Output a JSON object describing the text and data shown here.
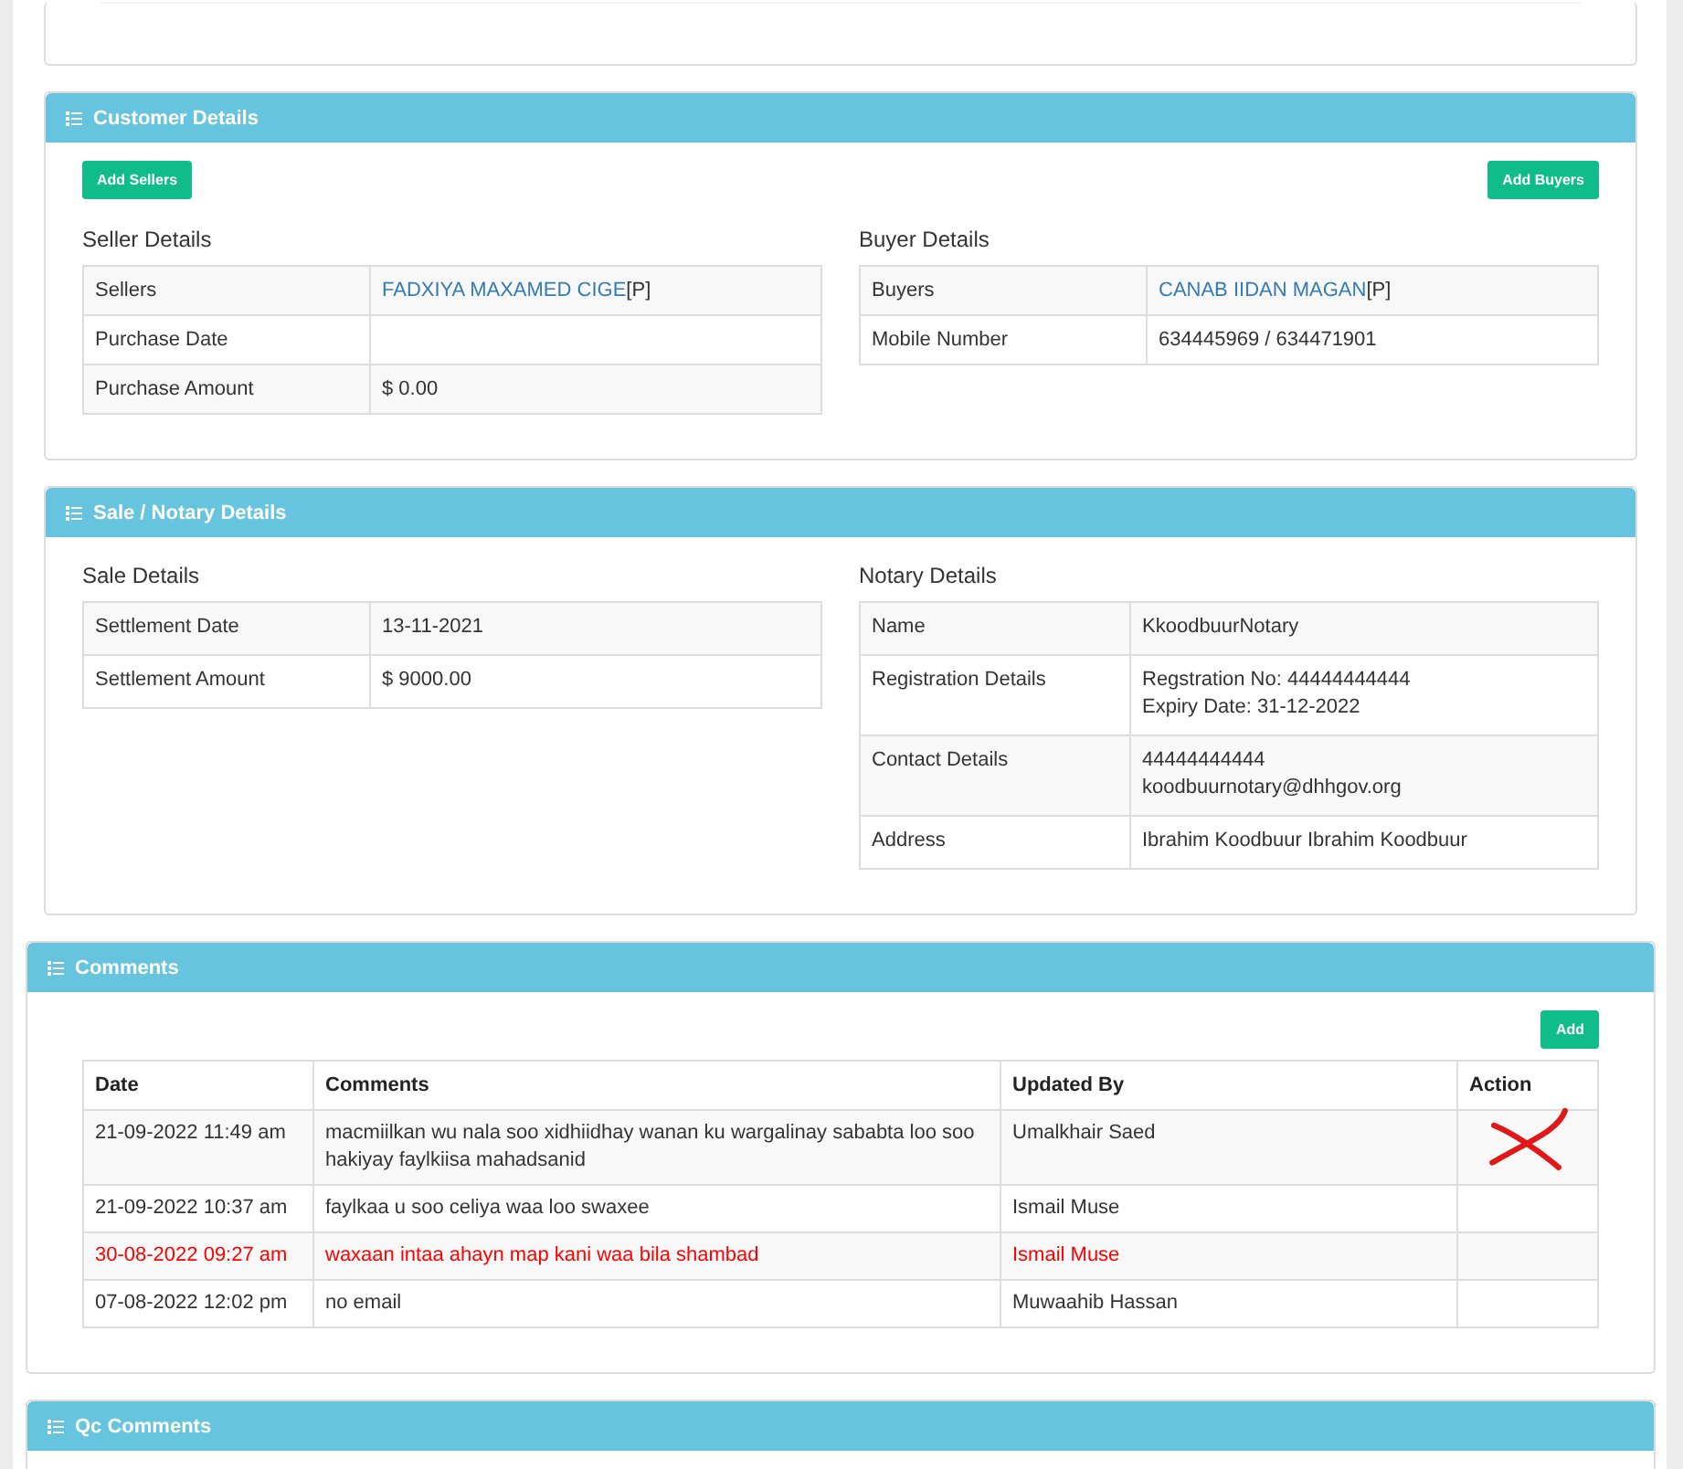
{
  "customer_panel": {
    "title": "Customer Details",
    "add_sellers": "Add Sellers",
    "add_buyers": "Add Buyers",
    "seller": {
      "heading": "Seller Details",
      "rows": [
        {
          "label": "Sellers",
          "link": "FADXIYA MAXAMED CIGE",
          "value": "[P]"
        },
        {
          "label": "Purchase Date"
        },
        {
          "label": "Purchase Amount",
          "value": "$ 0.00"
        }
      ]
    },
    "buyer": {
      "heading": "Buyer Details",
      "rows": [
        {
          "label": "Buyers",
          "link": "CANAB IIDAN MAGAN",
          "value": "[P]"
        },
        {
          "label": "Mobile Number",
          "value": "634445969 / 634471901"
        }
      ]
    }
  },
  "sale_panel": {
    "title": "Sale / Notary Details",
    "sale": {
      "heading": "Sale Details",
      "rows": [
        {
          "label": "Settlement Date",
          "lines": [
            "13-11-2021"
          ]
        },
        {
          "label": "Settlement Amount",
          "lines": [
            "$ 9000.00"
          ]
        }
      ]
    },
    "notary": {
      "heading": "Notary Details",
      "rows": [
        {
          "label": "Name",
          "lines": [
            "KkoodbuurNotary"
          ]
        },
        {
          "label": "Registration Details",
          "lines": [
            "Regstration No: 44444444444",
            "Expiry Date: 31-12-2022"
          ]
        },
        {
          "label": "Contact Details",
          "lines": [
            "44444444444",
            "koodbuurnotary@dhhgov.org"
          ]
        },
        {
          "label": "Address",
          "lines": [
            "Ibrahim Koodbuur Ibrahim Koodbuur"
          ]
        }
      ]
    }
  },
  "comments_panel": {
    "title": "Comments",
    "add": "Add",
    "columns": [
      "Date",
      "Comments",
      "Updated By",
      "Action"
    ],
    "rows": [
      {
        "date": "21-09-2022 11:49 am",
        "comment": "macmiilkan wu nala soo xidhiidhay wanan ku wargalinay sababta loo soo hakiyay faylkiisa mahadsanid",
        "updated_by": "Umalkhair Saed",
        "highlighted": false,
        "crossed": true
      },
      {
        "date": "21-09-2022 10:37 am",
        "comment": "faylkaa u soo celiya waa loo swaxee",
        "updated_by": "Ismail Muse",
        "highlighted": false,
        "crossed": false
      },
      {
        "date": "30-08-2022 09:27 am",
        "comment": "waxaan intaa ahayn map kani waa bila shambad",
        "updated_by": "Ismail Muse",
        "highlighted": true,
        "crossed": false
      },
      {
        "date": "07-08-2022 12:02 pm",
        "comment": "no email",
        "updated_by": "Muwaahib Hassan",
        "highlighted": false,
        "crossed": false
      }
    ]
  },
  "qc_panel": {
    "title": "Qc Comments"
  }
}
